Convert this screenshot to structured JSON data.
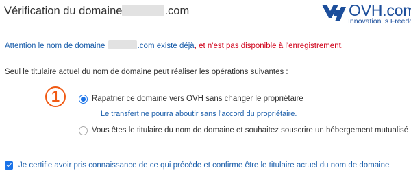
{
  "header": {
    "title_prefix": "Vérification du domaine",
    "title_suffix": ".com"
  },
  "logo": {
    "name": "OVH.com",
    "tagline": "Innovation is Freedom",
    "icon": "ovh-logo-icon"
  },
  "notice": {
    "part1": "Attention le nom de domaine ",
    "part2": ".com existe déjà",
    "part3": ", et n'est pas disponible à l'enregistrement."
  },
  "intro": "Seul le titulaire actuel du nom de domaine peut réaliser les opérations suivantes :",
  "step_marker": "1",
  "options": [
    {
      "label_before": "Rapatrier ce domaine vers OVH ",
      "label_underlined": "sans changer",
      "label_after": " le propriétaire",
      "note": "Le transfert ne pourra aboutir sans l'accord du propriétaire.",
      "selected": true
    },
    {
      "label": "Vous êtes le titulaire du nom de domaine et souhaitez souscrire un hébergement mutualisé",
      "selected": false
    }
  ],
  "certify": {
    "label": "Je certifie avoir pris connaissance de ce qui précède et confirme être le titulaire actuel du nom de domaine",
    "checked": true
  },
  "colors": {
    "accent": "#1a73e8",
    "link_blue": "#1c5fab",
    "error_red": "#d0021b",
    "step_orange": "#f05a14",
    "brand": "#1c4e9b"
  }
}
